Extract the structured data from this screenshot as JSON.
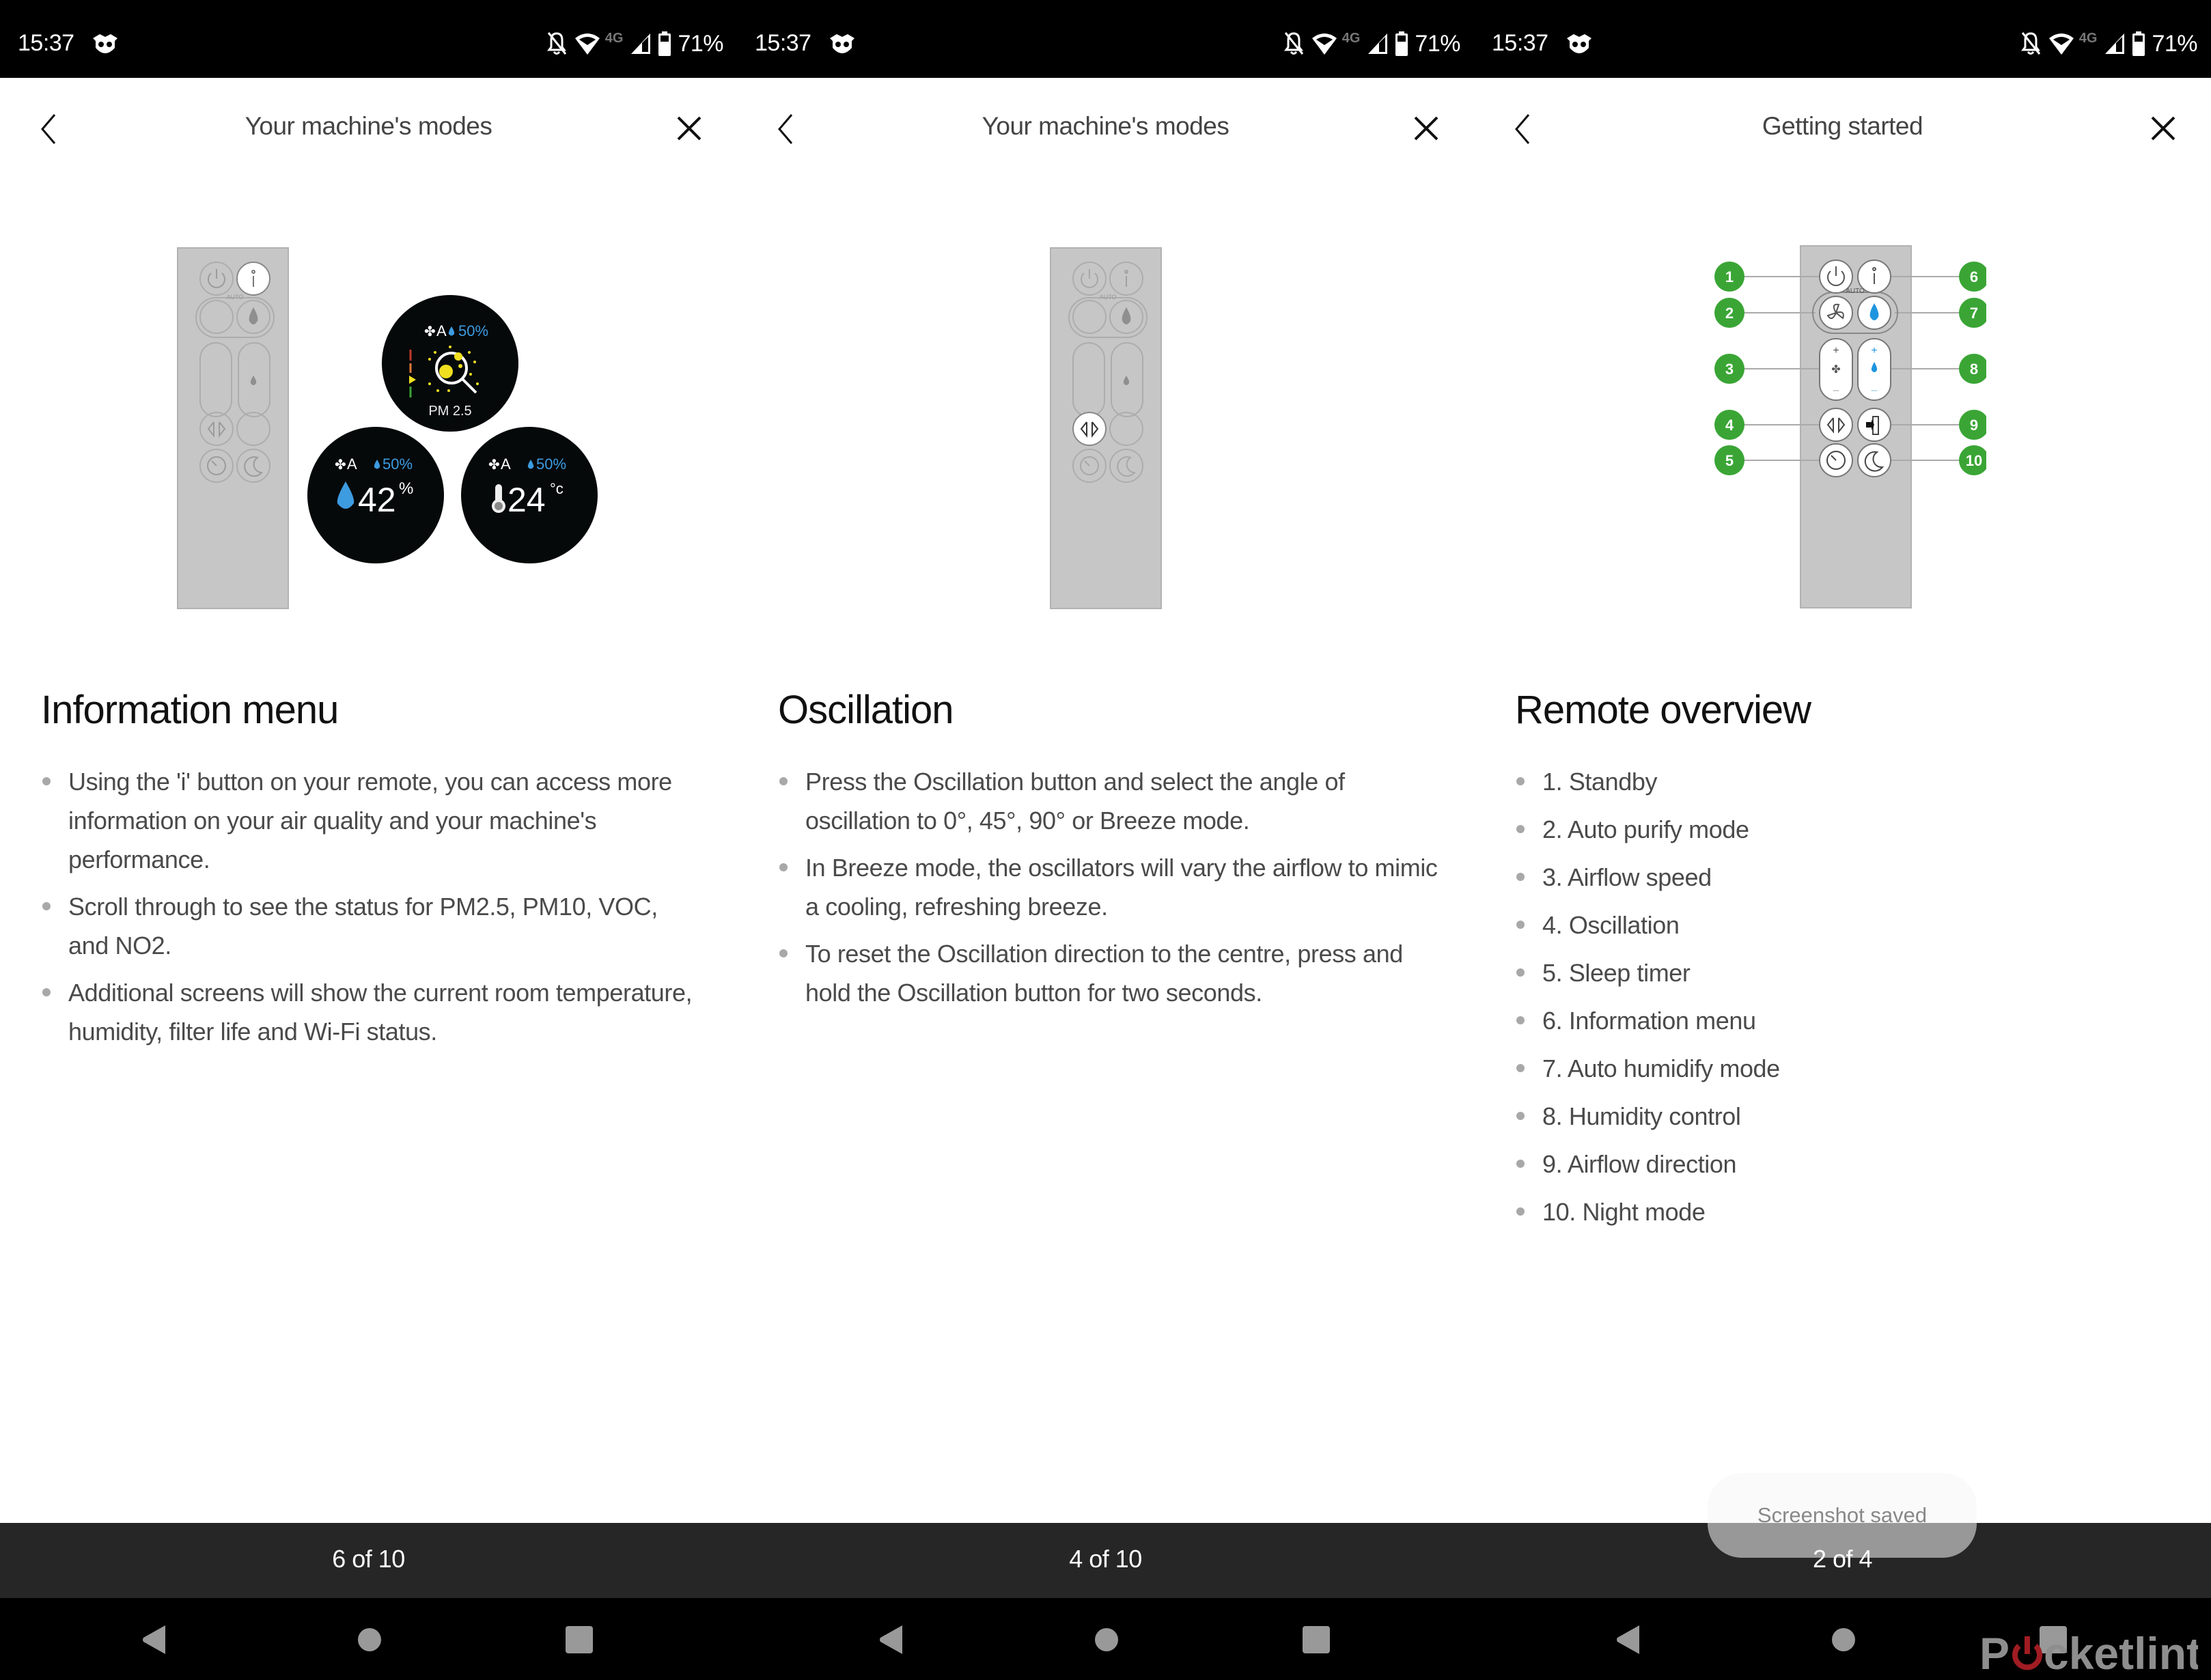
{
  "status_bar": {
    "time": "15:37",
    "network_label": "4G",
    "battery_percent": "71%",
    "icons": [
      "owl-app-icon",
      "notifications-muted-icon",
      "wifi-icon",
      "cell-signal-icon",
      "battery-icon"
    ]
  },
  "panels": [
    {
      "header": {
        "title": "Your machine's modes",
        "back_icon": "chevron-left-icon",
        "close_icon": "close-icon"
      },
      "illustration": {
        "highlighted_button": "information",
        "screens": [
          {
            "mode": "A",
            "target_humidity": "50%",
            "label": "PM 2.5"
          },
          {
            "mode": "A",
            "target_humidity": "50%",
            "reading": "42",
            "unit": "%"
          },
          {
            "mode": "A",
            "target_humidity": "50%",
            "reading": "24",
            "unit": "°c"
          }
        ]
      },
      "heading": "Information menu",
      "bullets": [
        "Using the 'i' button on your remote, you can access more information on your air quality and your machine's performance.",
        "Scroll through to see the status for PM2.5, PM10, VOC, and NO2.",
        "Additional screens will show the current room temperature, humidity, filter life and Wi-Fi status."
      ],
      "pager": "6 of 10"
    },
    {
      "header": {
        "title": "Your machine's modes",
        "back_icon": "chevron-left-icon",
        "close_icon": "close-icon"
      },
      "illustration": {
        "highlighted_button": "oscillation"
      },
      "heading": "Oscillation",
      "bullets": [
        "Press the Oscillation button and select the angle of oscillation to 0°, 45°, 90° or Breeze mode.",
        "In Breeze mode, the oscillators will vary the airflow to mimic a cooling, refreshing breeze.",
        "To reset the Oscillation direction to the centre, press and hold the Oscillation button for two seconds."
      ],
      "pager": "4 of 10"
    },
    {
      "header": {
        "title": "Getting started",
        "back_icon": "chevron-left-icon",
        "close_icon": "close-icon"
      },
      "illustration": {
        "auto_label": "AUTO",
        "callouts": [
          "1",
          "2",
          "3",
          "4",
          "5",
          "6",
          "7",
          "8",
          "9",
          "10"
        ],
        "callout_color": "#3aa535"
      },
      "heading": "Remote overview",
      "bullets": [
        "1. Standby",
        "2. Auto purify mode",
        "3. Airflow speed",
        "4. Oscillation",
        "5. Sleep timer",
        "6. Information menu",
        "7. Auto humidify mode",
        "8. Humidity control",
        "9. Airflow direction",
        "10. Night mode"
      ],
      "pager": "2 of 4"
    }
  ],
  "remote_auto_label": "AUTO",
  "toast": {
    "message": "Screenshot saved"
  },
  "watermark": {
    "text_before": "P",
    "text_after": "cketlint"
  },
  "colors": {
    "humidity_blue": "#3d9be0",
    "callout_green": "#3aa535",
    "pager_bg": "#262626",
    "remote_grey": "#c6c6c6"
  }
}
